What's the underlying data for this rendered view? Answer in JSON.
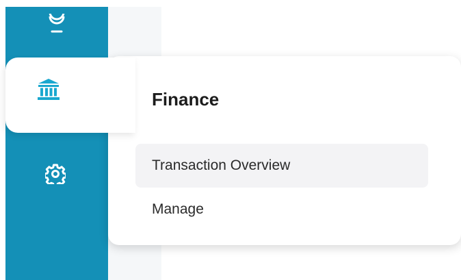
{
  "sidebar": {
    "items": [
      {
        "icon": "lightbulb-icon"
      },
      {
        "icon": "bank-icon",
        "active": true
      },
      {
        "icon": "gear-icon"
      }
    ]
  },
  "flyout": {
    "title": "Finance",
    "items": [
      {
        "label": "Transaction Overview",
        "highlighted": true
      },
      {
        "label": "Manage",
        "highlighted": false
      }
    ]
  },
  "colors": {
    "sidebar": "#1490b7",
    "accent": "#1aa8cf",
    "icon_light": "#ffffff",
    "highlight": "#f3f3f5"
  }
}
